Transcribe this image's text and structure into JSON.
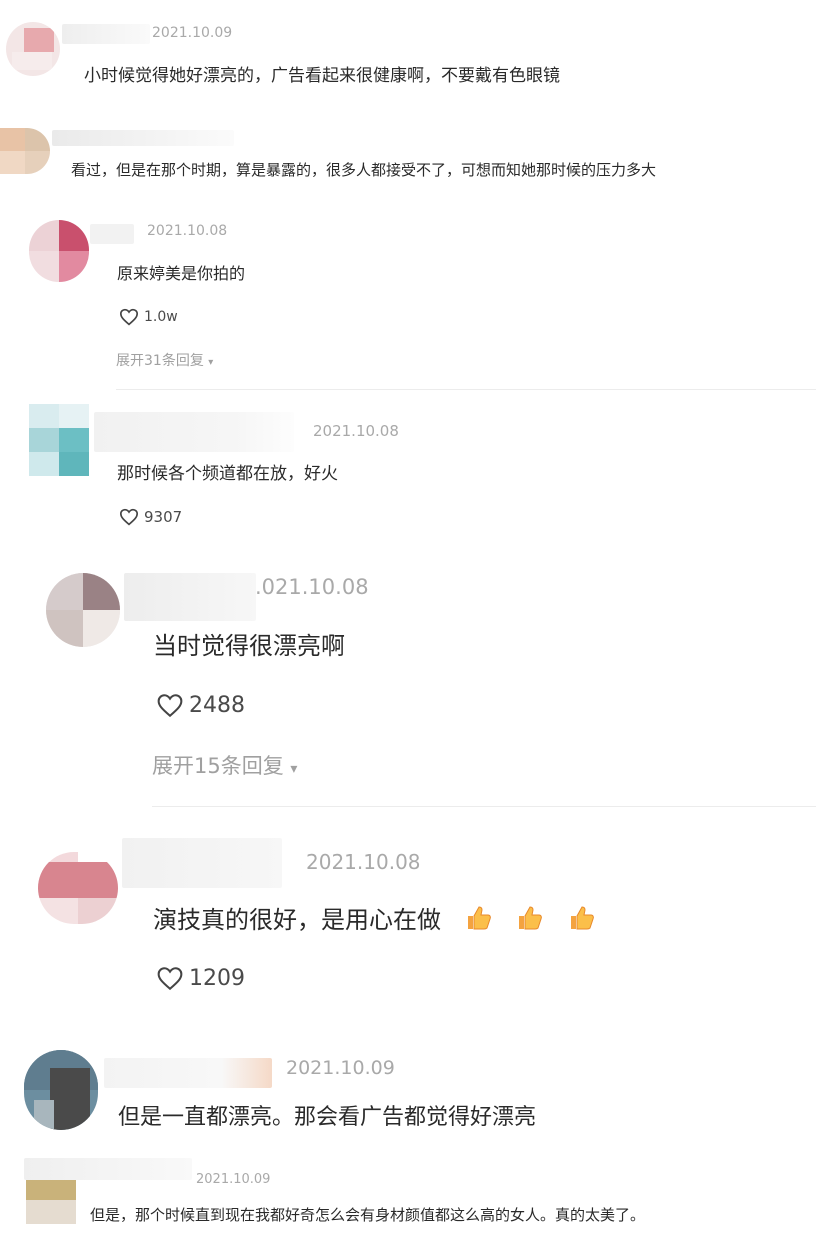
{
  "comments": [
    {
      "date": "2021.10.09",
      "text": "小时候觉得她好漂亮的，广告看起来很健康啊，不要戴有色眼镜"
    },
    {
      "date": "",
      "text": "看过，但是在那个时期，算是暴露的，很多人都接受不了，可想而知她那时候的压力多大"
    },
    {
      "date": "2021.10.08",
      "text": "原来婷美是你拍的",
      "likes": "1.0w",
      "expand": "展开31条回复"
    },
    {
      "date": "2021.10.08",
      "text": "那时候各个频道都在放，好火",
      "likes": "9307"
    },
    {
      "date": ".021.10.08",
      "text": "当时觉得很漂亮啊",
      "likes": "2488",
      "expand": "展开15条回复"
    },
    {
      "date": "2021.10.08",
      "text": "演技真的很好，是用心在做",
      "likes": "1209"
    },
    {
      "date": "2021.10.09",
      "text": "但是一直都漂亮。那会看广告都觉得好漂亮"
    },
    {
      "date": "2021.10.09",
      "text": "但是，那个时候直到现在我都好奇怎么会有身材颜值都这么高的女人。真的太美了。"
    }
  ],
  "icons": {
    "like": "heart-outline-icon",
    "expand": "chevron-down-icon",
    "emoji": "thumbs-up-emoji-icon"
  },
  "colors": {
    "date": "#a9a9a9",
    "expand": "#a0a0a0",
    "text": "#2a2a2a"
  }
}
